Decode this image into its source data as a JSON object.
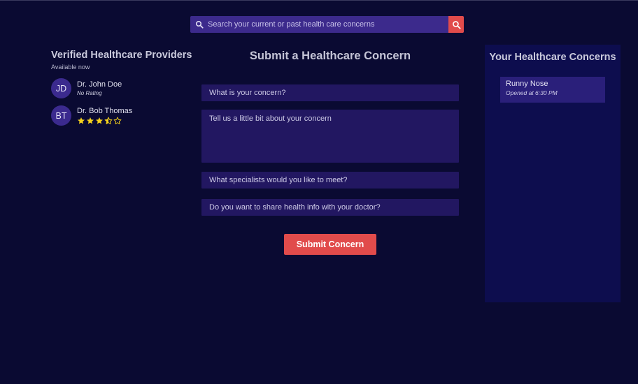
{
  "search": {
    "placeholder": "Search your current or past health care concerns",
    "button_icon": "search-icon"
  },
  "providers": {
    "title": "Verified Healthcare Providers",
    "subtitle": "Available now",
    "items": [
      {
        "initials": "JD",
        "name": "Dr. John Doe",
        "rating_text": "No Rating",
        "rating": null
      },
      {
        "initials": "BT",
        "name": "Dr. Bob Thomas",
        "rating_text": "",
        "rating": 3.5,
        "rating_max": 5
      }
    ]
  },
  "form": {
    "title": "Submit a Healthcare Concern",
    "concern_placeholder": "What is your concern?",
    "details_placeholder": "Tell us a little bit about your concern",
    "specialists_placeholder": "What specialists would you like to meet?",
    "share_info_placeholder": "Do you want to share health info with your doctor?",
    "submit_label": "Submit Concern"
  },
  "concerns": {
    "title": "Your Healthcare Concerns",
    "items": [
      {
        "name": "Runny Nose",
        "opened": "Opened at 6:30 PM"
      }
    ]
  },
  "colors": {
    "background": "#0a0a32",
    "accent": "#e14b4b",
    "field": "#221761",
    "panel": "#0d0d4e",
    "star": "#f5d21c"
  }
}
